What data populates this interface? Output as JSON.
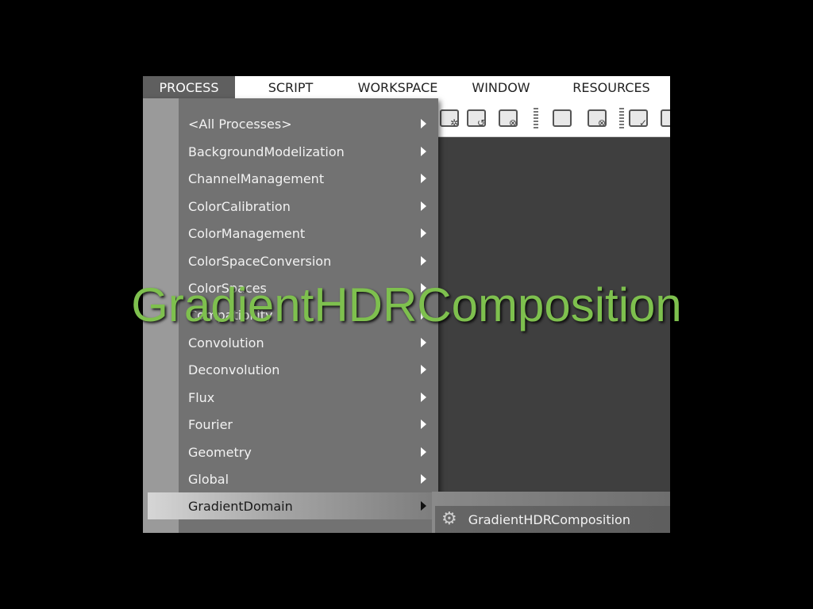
{
  "menubar": {
    "items": [
      {
        "label": "PROCESS"
      },
      {
        "label": "SCRIPT"
      },
      {
        "label": "WORKSPACE"
      },
      {
        "label": "WINDOW"
      },
      {
        "label": "RESOURCES"
      }
    ]
  },
  "process_menu": {
    "items": [
      {
        "label": "<All Processes>"
      },
      {
        "label": "BackgroundModelization"
      },
      {
        "label": "ChannelManagement"
      },
      {
        "label": "ColorCalibration"
      },
      {
        "label": "ColorManagement"
      },
      {
        "label": "ColorSpaceConversion"
      },
      {
        "label": "ColorSpaces"
      },
      {
        "label": "Compatibility"
      },
      {
        "label": "Convolution"
      },
      {
        "label": "Deconvolution"
      },
      {
        "label": "Flux"
      },
      {
        "label": "Fourier"
      },
      {
        "label": "Geometry"
      },
      {
        "label": "Global"
      },
      {
        "label": "GradientDomain"
      }
    ],
    "highlighted": "GradientDomain"
  },
  "submenu": {
    "items": [
      {
        "label": "GradientHDRComposition",
        "icon": "gear-icon"
      }
    ]
  },
  "caption": {
    "text": "GradientHDRComposition",
    "color": "#7ec04e"
  },
  "colors": {
    "menubar_active": "#5f5f5f",
    "dropdown_bg": "#727272",
    "workspace_bg": "#3f3f3f"
  }
}
